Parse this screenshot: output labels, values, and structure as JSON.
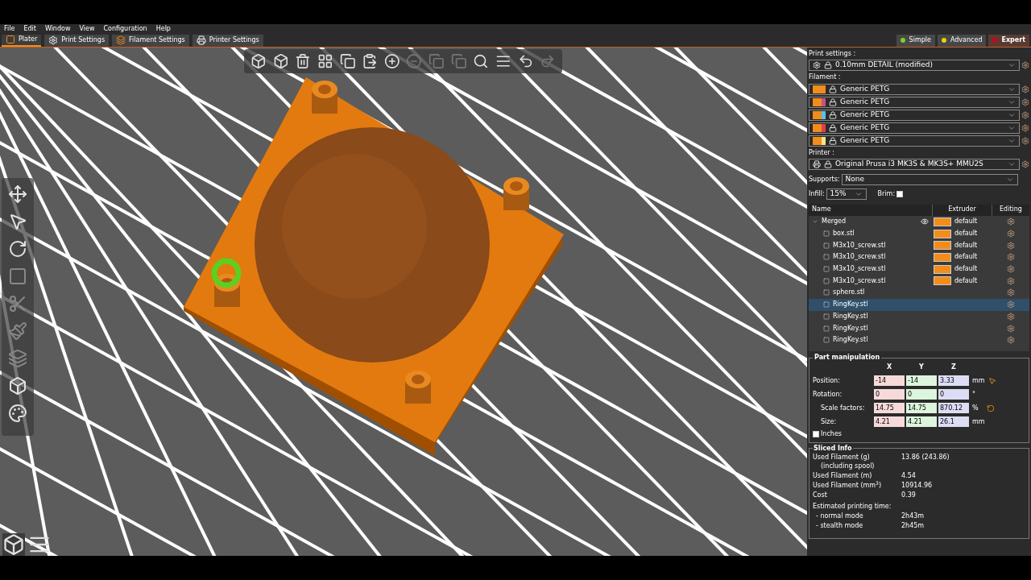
{
  "menu": [
    "File",
    "Edit",
    "Window",
    "View",
    "Configuration",
    "Help"
  ],
  "tabs": [
    {
      "label": "Plater",
      "kind": "plater",
      "selected": true
    },
    {
      "label": "Print Settings",
      "kind": "print",
      "selected": false
    },
    {
      "label": "Filament Settings",
      "kind": "filament",
      "selected": false
    },
    {
      "label": "Printer Settings",
      "kind": "printer",
      "selected": false
    }
  ],
  "modes": [
    {
      "label": "Simple",
      "color": "#7ed321",
      "selected": false
    },
    {
      "label": "Advanced",
      "color": "#f0d000",
      "selected": false
    },
    {
      "label": "Expert",
      "color": "#d0021b",
      "selected": true
    }
  ],
  "print_settings": {
    "label": "Print settings :",
    "value": "0.10mm DETAIL (modified)"
  },
  "filament": {
    "label": "Filament :",
    "items": [
      {
        "name": "Generic PETG",
        "color": "#f28c1b"
      },
      {
        "name": "Generic PETG",
        "color": "#c8508a"
      },
      {
        "name": "Generic PETG",
        "color": "#5bc0eb"
      },
      {
        "name": "Generic PETG",
        "color": "#e0404a"
      },
      {
        "name": "Generic PETG",
        "color": "#f5e68c"
      }
    ]
  },
  "printer": {
    "label": "Printer :",
    "value": "Original Prusa i3 MK3S & MK3S+ MMU2S"
  },
  "supports": {
    "label": "Supports:",
    "value": "None"
  },
  "infill": {
    "label": "Infill:",
    "value": "15%"
  },
  "brim": {
    "label": "Brim:",
    "checked": false
  },
  "object_list": {
    "columns": [
      "Name",
      "Extruder",
      "Editing"
    ],
    "rows": [
      {
        "name": "Merged",
        "extruder": "default",
        "expanded": true,
        "visible": true,
        "selected": false,
        "children": [
          {
            "name": "box.stl",
            "extruder": "default",
            "selected": false
          },
          {
            "name": "M3x10_screw.stl",
            "extruder": "default",
            "selected": false
          },
          {
            "name": "M3x10_screw.stl",
            "extruder": "default",
            "selected": false
          },
          {
            "name": "M3x10_screw.stl",
            "extruder": "default",
            "selected": false
          },
          {
            "name": "M3x10_screw.stl",
            "extruder": "default",
            "selected": false
          },
          {
            "name": "sphere.stl",
            "selected": false
          },
          {
            "name": "RingKey.stl",
            "selected": true
          },
          {
            "name": "RingKey.stl",
            "selected": false
          },
          {
            "name": "RingKey.stl",
            "selected": false
          },
          {
            "name": "RingKey.stl",
            "selected": false
          }
        ]
      }
    ]
  },
  "part_manipulation": {
    "title": "Part manipulation",
    "axes": [
      "X",
      "Y",
      "Z"
    ],
    "rows": [
      {
        "label": "Position:",
        "values": [
          "-14",
          "-14",
          "3.33"
        ],
        "unit": "mm"
      },
      {
        "label": "Rotation:",
        "values": [
          "0",
          "0",
          "0"
        ],
        "unit": "°"
      },
      {
        "label": "Scale factors:",
        "values": [
          "14.75",
          "14.75",
          "870.12"
        ],
        "unit": "%"
      },
      {
        "label": "Size:",
        "values": [
          "4.21",
          "4.21",
          "26.1"
        ],
        "unit": "mm"
      }
    ],
    "inches": {
      "label": "Inches",
      "checked": false
    }
  },
  "sliced_info": {
    "title": "Sliced Info",
    "rows": [
      {
        "label": "Used Filament (g)",
        "sub": "(including spool)",
        "value": "13.86 (243.86)"
      },
      {
        "label": "Used Filament (m)",
        "value": "4.54"
      },
      {
        "label": "Used Filament (mm$^{3}$)",
        "value": "10914.96"
      },
      {
        "label": "Cost",
        "value": "0.39"
      }
    ],
    "time_label": "Estimated printing time:",
    "times": [
      {
        "label": "- normal mode",
        "value": "2h43m"
      },
      {
        "label": "- stealth mode",
        "value": "2h45m"
      }
    ]
  }
}
